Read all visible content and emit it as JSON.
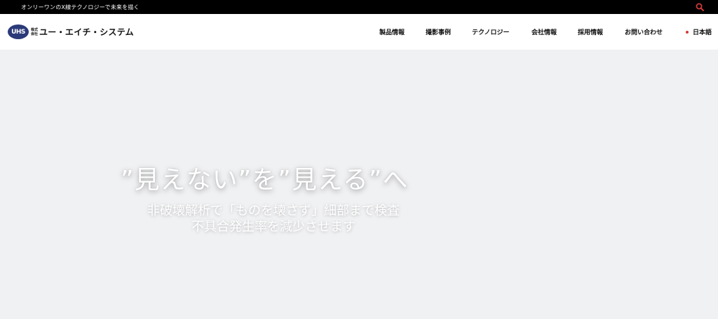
{
  "topbar": {
    "tagline": "オンリーワンのX線テクノロジーで未来を描く",
    "search_icon": "search-icon"
  },
  "header": {
    "logo_mark": "UHS",
    "logo_kabu": "株式会社",
    "logo_name": "ユー・エイチ・システム"
  },
  "nav": {
    "items": [
      {
        "label": "製品情報"
      },
      {
        "label": "撮影事例"
      },
      {
        "label": "テクノロジー"
      },
      {
        "label": "会社情報"
      },
      {
        "label": "採用情報"
      },
      {
        "label": "お問い合わせ"
      }
    ],
    "language": "日本語"
  },
  "hero": {
    "title": "”見えない”を”見える”へ",
    "subtitle_line1": "非破壊解析で「ものを壊さず」細部まで検査",
    "subtitle_line2": "不具合発生率を減少させます"
  },
  "colors": {
    "topbar_bg": "#000000",
    "accent_red": "#d13a3a",
    "logo_blue": "#2b3a78",
    "hero_bg": "#f0f1f3"
  }
}
